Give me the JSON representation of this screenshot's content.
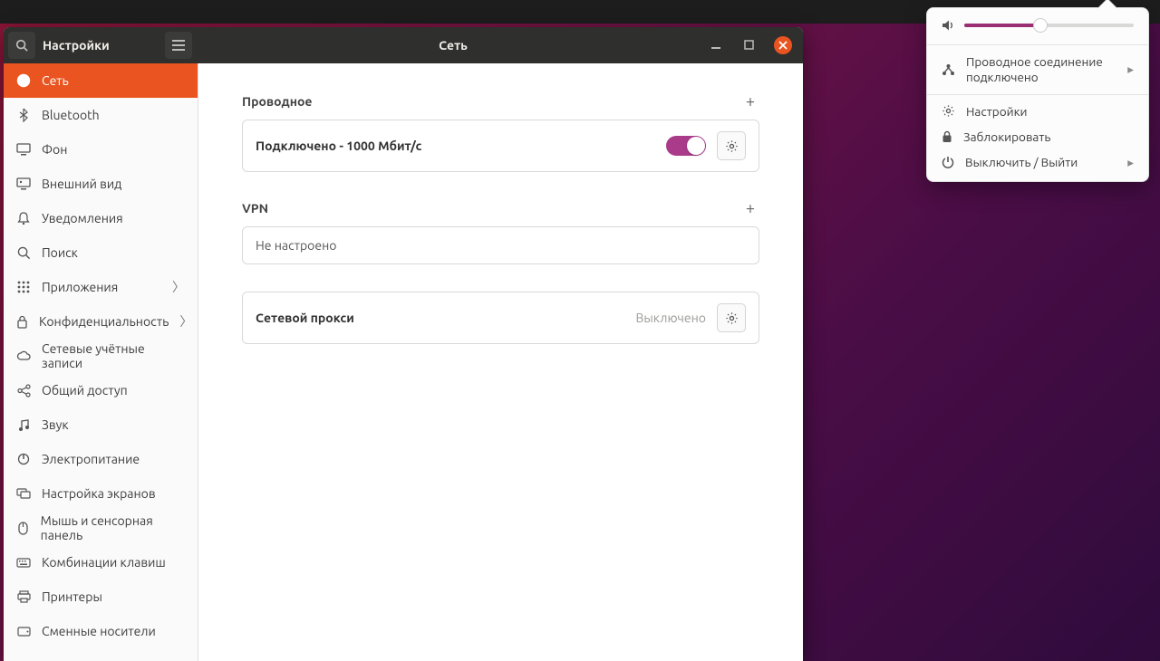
{
  "header": {
    "app_title": "Настройки",
    "page_title": "Сеть"
  },
  "sidebar": {
    "items": [
      {
        "label": "Сеть"
      },
      {
        "label": "Bluetooth"
      },
      {
        "label": "Фон"
      },
      {
        "label": "Внешний вид"
      },
      {
        "label": "Уведомления"
      },
      {
        "label": "Поиск"
      },
      {
        "label": "Приложения",
        "chevron": true
      },
      {
        "label": "Конфиденциальность",
        "chevron": true
      },
      {
        "label": "Сетевые учётные записи"
      },
      {
        "label": "Общий доступ"
      },
      {
        "label": "Звук"
      },
      {
        "label": "Электропитание"
      },
      {
        "label": "Настройка экранов"
      },
      {
        "label": "Мышь и сенсорная панель"
      },
      {
        "label": "Комбинации клавиш"
      },
      {
        "label": "Принтеры"
      },
      {
        "label": "Сменные носители"
      }
    ]
  },
  "content": {
    "wired": {
      "title": "Проводное",
      "status": "Подключено - 1000 Мбит/с",
      "toggle": true
    },
    "vpn": {
      "title": "VPN",
      "status": "Не настроено"
    },
    "proxy": {
      "title": "Сетевой прокси",
      "status": "Выключено"
    }
  },
  "system_menu": {
    "volume": 45,
    "wired": {
      "line1": "Проводное соединение",
      "line2": "подключено"
    },
    "settings": "Настройки",
    "lock": "Заблокировать",
    "power": "Выключить / Выйти"
  }
}
